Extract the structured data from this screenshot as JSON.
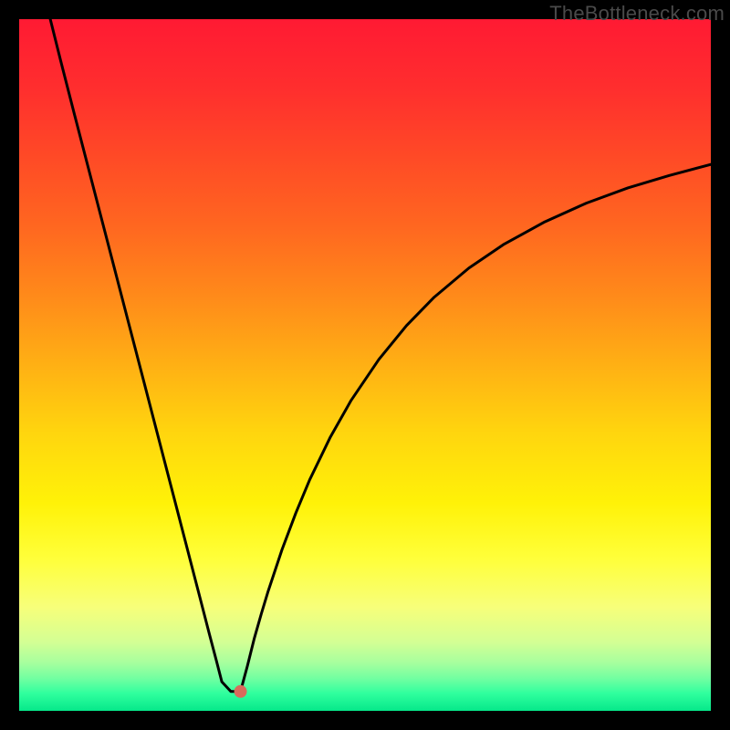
{
  "watermark": "TheBottleneck.com",
  "chart_data": {
    "type": "line",
    "title": "",
    "xlabel": "",
    "ylabel": "",
    "xlim": [
      0,
      100
    ],
    "ylim": [
      0,
      100
    ],
    "grid": false,
    "legend": false,
    "background_gradient": {
      "stops": [
        {
          "offset": 0.0,
          "color": "#ff1a33"
        },
        {
          "offset": 0.1,
          "color": "#ff2e2e"
        },
        {
          "offset": 0.2,
          "color": "#ff4a26"
        },
        {
          "offset": 0.3,
          "color": "#ff6720"
        },
        {
          "offset": 0.4,
          "color": "#ff8a1a"
        },
        {
          "offset": 0.5,
          "color": "#ffb014"
        },
        {
          "offset": 0.6,
          "color": "#ffd60e"
        },
        {
          "offset": 0.7,
          "color": "#fff208"
        },
        {
          "offset": 0.78,
          "color": "#ffff3a"
        },
        {
          "offset": 0.85,
          "color": "#f7ff7a"
        },
        {
          "offset": 0.9,
          "color": "#d4ff94"
        },
        {
          "offset": 0.93,
          "color": "#a8ff9e"
        },
        {
          "offset": 0.955,
          "color": "#6dffa1"
        },
        {
          "offset": 0.975,
          "color": "#2fff9e"
        },
        {
          "offset": 1.0,
          "color": "#06e88a"
        }
      ]
    },
    "series": [
      {
        "name": "left-branch",
        "x": [
          4.5,
          6,
          8,
          10,
          12,
          14,
          16,
          18,
          20,
          22,
          24,
          26,
          27.5,
          28.5,
          29.3,
          30.6,
          31.6
        ],
        "y": [
          100,
          94.0,
          86.2,
          78.5,
          70.8,
          63.1,
          55.4,
          47.7,
          40.0,
          32.3,
          24.6,
          16.9,
          11.1,
          7.3,
          4.2,
          2.8,
          2.8
        ]
      },
      {
        "name": "right-branch",
        "x": [
          32.0,
          33,
          34,
          35,
          36,
          38,
          40,
          42,
          45,
          48,
          52,
          56,
          60,
          65,
          70,
          76,
          82,
          88,
          94,
          100
        ],
        "y": [
          2.8,
          6.5,
          10.5,
          14.0,
          17.3,
          23.3,
          28.6,
          33.4,
          39.6,
          44.9,
          50.8,
          55.7,
          59.8,
          64.0,
          67.4,
          70.7,
          73.4,
          75.6,
          77.4,
          79.0
        ]
      }
    ],
    "marker": {
      "x": 32.0,
      "y": 2.8,
      "color": "#d86a5c",
      "radius_px": 7
    }
  }
}
